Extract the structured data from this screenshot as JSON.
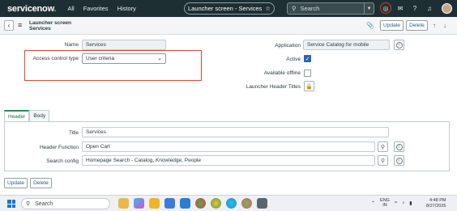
{
  "topnav": {
    "logo_main": "servicenow",
    "logo_dot": ".",
    "links": [
      "All",
      "Favorites",
      "History"
    ],
    "context_title": "Launcher screen - Services",
    "context_star": "☆",
    "search_placeholder": "Search"
  },
  "form": {
    "title_line1": "Launcher screen",
    "title_line2": "Services",
    "update_label": "Update",
    "delete_label": "Delete"
  },
  "fields": {
    "name_label": "Name",
    "name_value": "Services",
    "access_label": "Access control type",
    "access_value": "User criteria",
    "application_label": "Application",
    "application_value": "Service Catalog for mobile",
    "active_label": "Active",
    "active_checked": true,
    "offline_label": "Available offline",
    "offline_checked": false,
    "launcher_titles_label": "Launcher Header Titles"
  },
  "tabs": [
    {
      "label": "Header",
      "active": true
    },
    {
      "label": "Body",
      "active": false
    }
  ],
  "header_section": {
    "title_label": "Title",
    "title_value": "Services",
    "function_label": "Header Function",
    "function_value": "Open Cart",
    "search_label": "Search config",
    "search_value": "Homepage Search - Catalog, Knowledge, People"
  },
  "bottom": {
    "update_label": "Update",
    "delete_label": "Delete"
  },
  "taskbar": {
    "search_text": "Search",
    "lang_line1": "ENG",
    "lang_line2": "IN",
    "time": "4:48 PM",
    "date": "8/27/2025"
  },
  "colors": {
    "nav_bg": "#1e2f33",
    "accent_green": "#62d84e",
    "highlight_red": "#e4443a",
    "checkbox_blue": "#2b62b8"
  }
}
